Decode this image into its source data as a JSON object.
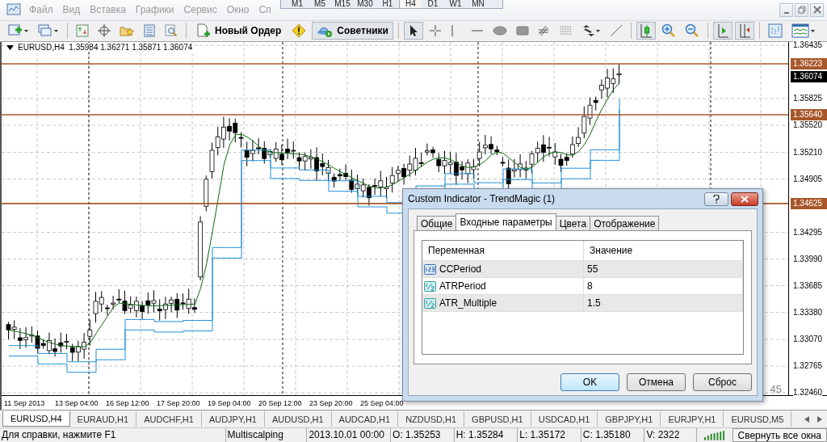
{
  "menu": {
    "items": [
      "Файл",
      "Вид",
      "Вставка",
      "Графики",
      "Сервис",
      "Окно",
      "Сп"
    ]
  },
  "timeframes": [
    {
      "label": "M1",
      "selected": false
    },
    {
      "label": "M5",
      "selected": false
    },
    {
      "label": "M15",
      "selected": false
    },
    {
      "label": "M30",
      "selected": false
    },
    {
      "label": "H1",
      "selected": false
    },
    {
      "label": "H4",
      "selected": true
    },
    {
      "label": "D1",
      "selected": false
    },
    {
      "label": "W1",
      "selected": false
    },
    {
      "label": "MN",
      "selected": false
    }
  ],
  "toolbar": [
    {
      "kind": "newchart",
      "pressed": false
    },
    {
      "kind": "profiles",
      "pressed": false
    },
    {
      "kind": "separator"
    },
    {
      "kind": "market",
      "pressed": false
    },
    {
      "kind": "datawindow",
      "pressed": false
    },
    {
      "kind": "navigator",
      "pressed": false
    },
    {
      "kind": "terminal",
      "pressed": false
    },
    {
      "kind": "tester",
      "pressed": false
    },
    {
      "kind": "separator"
    },
    {
      "kind": "order",
      "label": "Новый Ордер",
      "pressed": false
    },
    {
      "kind": "autotrade",
      "pressed": false
    },
    {
      "kind": "experts",
      "label": "Советники",
      "pressed": true
    },
    {
      "kind": "separator"
    },
    {
      "kind": "cursor",
      "pressed": true
    },
    {
      "kind": "crosshair",
      "pressed": false
    },
    {
      "kind": "vline",
      "pressed": false
    },
    {
      "kind": "hline",
      "pressed": false
    },
    {
      "kind": "ellipse",
      "pressed": false
    },
    {
      "kind": "rectangle",
      "pressed": false
    },
    {
      "kind": "fiboe",
      "pressed": false
    },
    {
      "kind": "fibof",
      "pressed": false
    },
    {
      "kind": "arrows",
      "pressed": false
    },
    {
      "kind": "trendline",
      "pressed": false
    },
    {
      "kind": "separator"
    },
    {
      "kind": "candles",
      "pressed": true
    },
    {
      "kind": "zoomin",
      "pressed": false
    },
    {
      "kind": "zoomout",
      "pressed": false
    },
    {
      "kind": "separator"
    },
    {
      "kind": "autoscroll",
      "pressed": true
    },
    {
      "kind": "shift",
      "pressed": true
    },
    {
      "kind": "separator"
    },
    {
      "kind": "periods",
      "pressed": false
    },
    {
      "kind": "templates",
      "pressed": false
    }
  ],
  "chart": {
    "header": "EURUSD,H4  1.35984 1.36271 1.35871 1.36074",
    "price_ticks": [
      "1.36435",
      "1.35825",
      "1.35520",
      "1.35210",
      "1.34905",
      "1.34295",
      "1.33990",
      "1.33685",
      "1.33380",
      "1.33070",
      "1.32765",
      "1.32460"
    ],
    "price_tags": [
      {
        "label": "1.36223",
        "kind": "level"
      },
      {
        "label": "1.36074",
        "kind": "bid"
      },
      {
        "label": "1.35640",
        "kind": "level"
      },
      {
        "label": "1.34625",
        "kind": "level"
      }
    ],
    "time_labels": [
      "11 Sep 2013",
      "13 Sep 04:00",
      "16 Sep 12:00",
      "17 Sep 20:00",
      "19 Sep 04:00",
      "20 Sep 12:00",
      "23 Sep 20:00",
      "25 Sep 04:00"
    ],
    "corner_text": "45"
  },
  "dialog": {
    "title": "Custom Indicator - TrendMagic (1)",
    "tabs": [
      {
        "label": "Общие",
        "selected": false
      },
      {
        "label": "Входные параметры",
        "selected": true
      },
      {
        "label": "Цвета",
        "selected": false
      },
      {
        "label": "Отображение",
        "selected": false
      }
    ],
    "columns": [
      "Переменная",
      "Значение"
    ],
    "rows": [
      {
        "kind": "int",
        "name": "CCPeriod",
        "value": "55"
      },
      {
        "kind": "double",
        "name": "ATRPeriod",
        "value": "8"
      },
      {
        "kind": "double",
        "name": "ATR_Multiple",
        "value": "1.5"
      }
    ],
    "buttons": [
      {
        "label": "OK",
        "default": true
      },
      {
        "label": "Отмена",
        "default": false
      },
      {
        "label": "Сброс",
        "default": false
      }
    ]
  },
  "chart_tabs": [
    {
      "label": "EURUSD,H4",
      "selected": true
    },
    {
      "label": "EURAUD,H1",
      "selected": false
    },
    {
      "label": "AUDCHF,H1",
      "selected": false
    },
    {
      "label": "AUDJPY,H1",
      "selected": false
    },
    {
      "label": "AUDUSD,H1",
      "selected": false
    },
    {
      "label": "AUDCAD,H1",
      "selected": false
    },
    {
      "label": "NZDUSD,H1",
      "selected": false
    },
    {
      "label": "GBPUSD,H1",
      "selected": false
    },
    {
      "label": "USDCAD,H1",
      "selected": false
    },
    {
      "label": "GBPJPY,H1",
      "selected": false
    },
    {
      "label": "EURJPY,H1",
      "selected": false
    },
    {
      "label": "EURUSD,M5",
      "selected": false
    }
  ],
  "status_bar": {
    "fields": [
      "Для справки, нажмите F1",
      "Multiscalping",
      "2013.10.01 00:00",
      "O: 1.35253",
      "H: 1.35284",
      "L: 1.35172",
      "C: 1.35180",
      "V: 2322"
    ],
    "button": "Свернуть все окна"
  }
}
